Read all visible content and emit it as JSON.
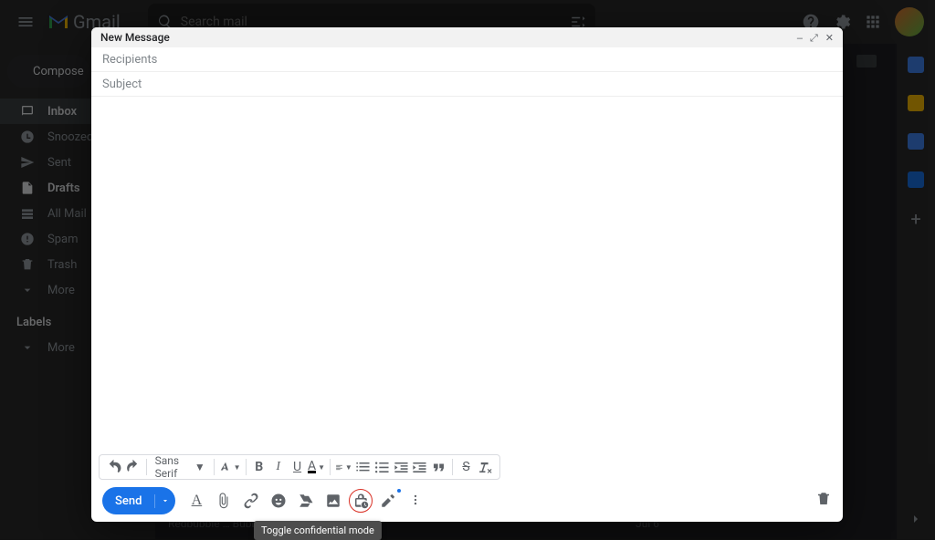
{
  "app": {
    "name": "Gmail"
  },
  "search": {
    "placeholder": "Search mail"
  },
  "compose_button": "Compose",
  "sidebar": {
    "items": [
      {
        "label": "Inbox",
        "active": true
      },
      {
        "label": "Snoozed"
      },
      {
        "label": "Sent"
      },
      {
        "label": "Drafts",
        "bold": true
      },
      {
        "label": "All Mail"
      },
      {
        "label": "Spam"
      },
      {
        "label": "Trash"
      },
      {
        "label": "More"
      }
    ],
    "labels_header": "Labels",
    "labels_more": "More"
  },
  "compose": {
    "title": "New Message",
    "recipients_placeholder": "Recipients",
    "subject_placeholder": "Subject",
    "send_label": "Send",
    "font_name": "Sans Serif",
    "tooltip_confidential": "Toggle confidential mode"
  },
  "background_row": {
    "snippet": "Redbubble … Bubble Wrap: Medal Worthy…",
    "date": "Jul 6"
  }
}
